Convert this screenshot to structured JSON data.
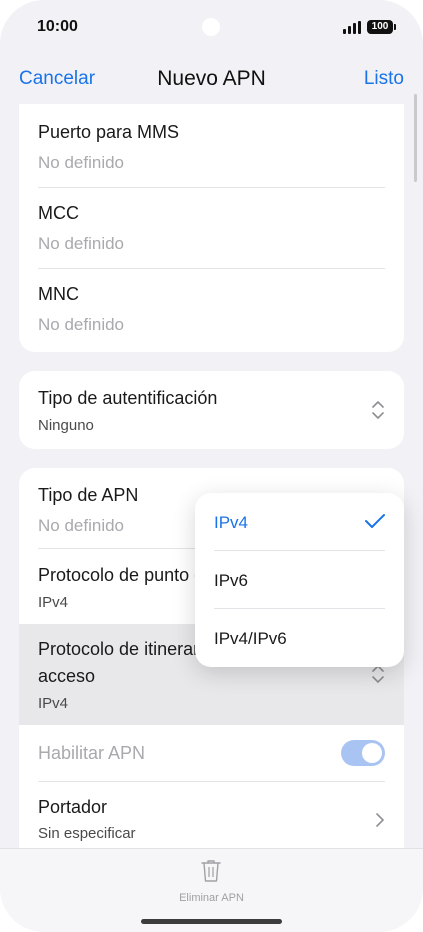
{
  "status_bar": {
    "time": "10:00",
    "battery": "100"
  },
  "nav": {
    "cancel_label": "Cancelar",
    "title": "Nuevo APN",
    "done_label": "Listo"
  },
  "card1": {
    "rows": [
      {
        "title": "Puerto para MMS",
        "value": "No definido"
      },
      {
        "title": "MCC",
        "value": "No definido"
      },
      {
        "title": "MNC",
        "value": "No definido"
      }
    ]
  },
  "auth": {
    "title": "Tipo de autentificación",
    "value": "Ninguno"
  },
  "card3": {
    "apn_type": {
      "title": "Tipo de APN",
      "value": "No definido"
    },
    "protocol": {
      "title": "Protocolo de punto de acceso",
      "value": "IPv4"
    },
    "roaming_protocol": {
      "title_line1": "Protocolo de itinerancia del punto de",
      "title_line2": "acceso",
      "value": "IPv4"
    },
    "enable_apn": {
      "title": "Habilitar APN",
      "enabled": true
    },
    "bearer": {
      "title": "Portador",
      "value": "Sin especificar"
    }
  },
  "popup": {
    "options": [
      {
        "label": "IPv4",
        "selected": true
      },
      {
        "label": "IPv6",
        "selected": false
      },
      {
        "label": "IPv4/IPv6",
        "selected": false
      }
    ]
  },
  "bottom": {
    "delete_label": "Eliminar APN"
  },
  "colors": {
    "accent": "#1a73e8",
    "toggle_on": "#a9c4f3",
    "background": "#f2f2f6"
  },
  "icons": [
    "chevron-updown-icon",
    "chevron-right-icon",
    "check-icon",
    "trash-icon",
    "signal-icon",
    "battery-icon"
  ]
}
